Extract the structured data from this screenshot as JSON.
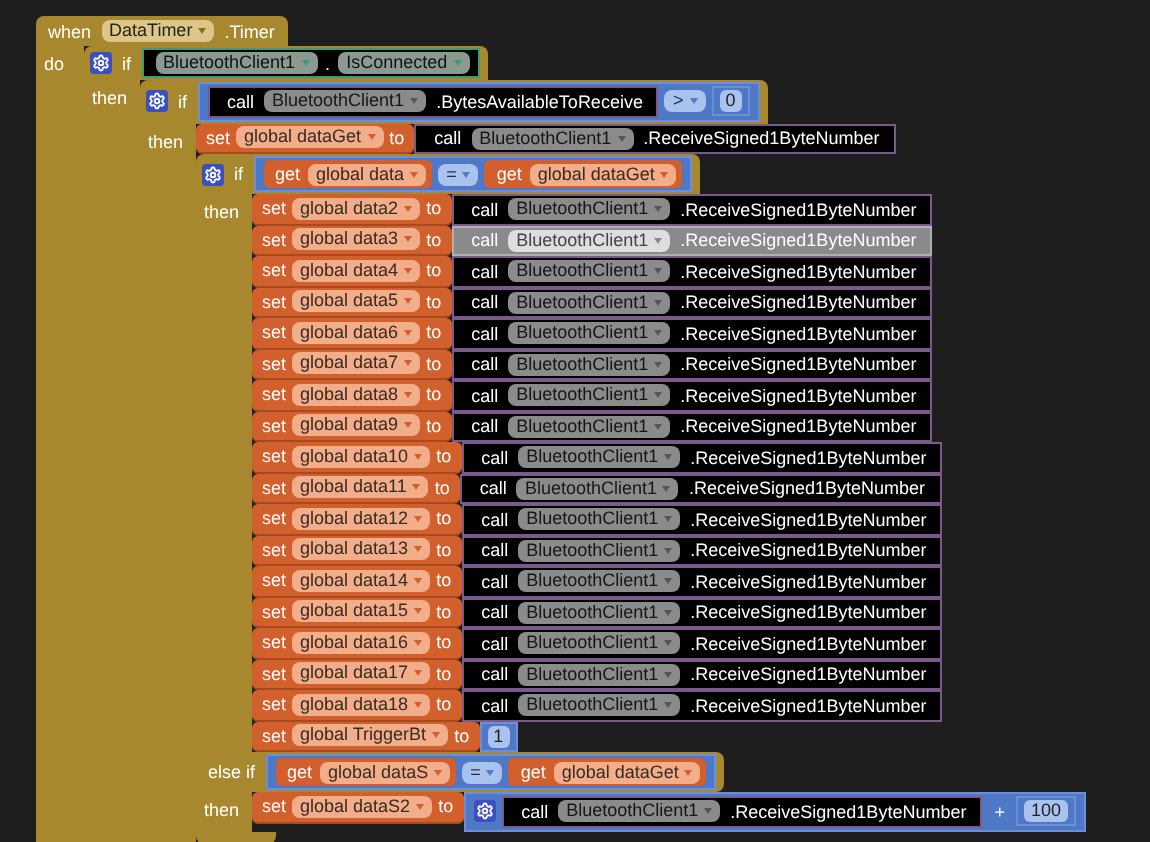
{
  "event": {
    "keyword": "when",
    "component": "DataTimer",
    "event": ".Timer",
    "body_label": "do",
    "body": [
      {
        "kind": "if",
        "keyword": "if",
        "mutator": true,
        "condition": {
          "kind": "property",
          "component": "BluetoothClient1",
          "separator": ".",
          "property": "IsConnected"
        },
        "then_label": "then",
        "body": [
          {
            "kind": "if",
            "keyword": "if",
            "mutator": true,
            "condition": {
              "kind": "compare",
              "operator": ">",
              "left": {
                "kind": "call",
                "keyword": "call",
                "component": "BluetoothClient1",
                "method": ".BytesAvailableToReceive",
                "selected": false
              },
              "right": {
                "kind": "number",
                "value": "0"
              }
            },
            "then_label": "then",
            "body": [
              {
                "kind": "set",
                "keyword": "set",
                "variable": "global dataGet",
                "to": "to",
                "value": {
                  "kind": "call",
                  "keyword": "call",
                  "component": "BluetoothClient1",
                  "method": ".ReceiveSigned1ByteNumber",
                  "selected": false
                }
              },
              {
                "kind": "if",
                "keyword": "if",
                "mutator": true,
                "condition": {
                  "kind": "compare",
                  "operator": "=",
                  "left": {
                    "kind": "get",
                    "keyword": "get",
                    "variable": "global data"
                  },
                  "right": {
                    "kind": "get",
                    "keyword": "get",
                    "variable": "global dataGet"
                  }
                },
                "then_label": "then",
                "body": [
                  {
                    "kind": "set",
                    "keyword": "set",
                    "variable": "global data2",
                    "to": "to",
                    "value": {
                      "kind": "call",
                      "keyword": "call",
                      "component": "BluetoothClient1",
                      "method": ".ReceiveSigned1ByteNumber",
                      "selected": false
                    }
                  },
                  {
                    "kind": "set",
                    "keyword": "set",
                    "variable": "global data3",
                    "to": "to",
                    "value": {
                      "kind": "call",
                      "keyword": "call",
                      "component": "BluetoothClient1",
                      "method": ".ReceiveSigned1ByteNumber",
                      "selected": true
                    }
                  },
                  {
                    "kind": "set",
                    "keyword": "set",
                    "variable": "global data4",
                    "to": "to",
                    "value": {
                      "kind": "call",
                      "keyword": "call",
                      "component": "BluetoothClient1",
                      "method": ".ReceiveSigned1ByteNumber",
                      "selected": false
                    }
                  },
                  {
                    "kind": "set",
                    "keyword": "set",
                    "variable": "global data5",
                    "to": "to",
                    "value": {
                      "kind": "call",
                      "keyword": "call",
                      "component": "BluetoothClient1",
                      "method": ".ReceiveSigned1ByteNumber",
                      "selected": false
                    }
                  },
                  {
                    "kind": "set",
                    "keyword": "set",
                    "variable": "global data6",
                    "to": "to",
                    "value": {
                      "kind": "call",
                      "keyword": "call",
                      "component": "BluetoothClient1",
                      "method": ".ReceiveSigned1ByteNumber",
                      "selected": false
                    }
                  },
                  {
                    "kind": "set",
                    "keyword": "set",
                    "variable": "global data7",
                    "to": "to",
                    "value": {
                      "kind": "call",
                      "keyword": "call",
                      "component": "BluetoothClient1",
                      "method": ".ReceiveSigned1ByteNumber",
                      "selected": false
                    }
                  },
                  {
                    "kind": "set",
                    "keyword": "set",
                    "variable": "global data8",
                    "to": "to",
                    "value": {
                      "kind": "call",
                      "keyword": "call",
                      "component": "BluetoothClient1",
                      "method": ".ReceiveSigned1ByteNumber",
                      "selected": false
                    }
                  },
                  {
                    "kind": "set",
                    "keyword": "set",
                    "variable": "global data9",
                    "to": "to",
                    "value": {
                      "kind": "call",
                      "keyword": "call",
                      "component": "BluetoothClient1",
                      "method": ".ReceiveSigned1ByteNumber",
                      "selected": false
                    }
                  },
                  {
                    "kind": "set",
                    "keyword": "set",
                    "variable": "global data10",
                    "to": "to",
                    "value": {
                      "kind": "call",
                      "keyword": "call",
                      "component": "BluetoothClient1",
                      "method": ".ReceiveSigned1ByteNumber",
                      "selected": false
                    }
                  },
                  {
                    "kind": "set",
                    "keyword": "set",
                    "variable": "global data11",
                    "to": "to",
                    "value": {
                      "kind": "call",
                      "keyword": "call",
                      "component": "BluetoothClient1",
                      "method": ".ReceiveSigned1ByteNumber",
                      "selected": false
                    }
                  },
                  {
                    "kind": "set",
                    "keyword": "set",
                    "variable": "global data12",
                    "to": "to",
                    "value": {
                      "kind": "call",
                      "keyword": "call",
                      "component": "BluetoothClient1",
                      "method": ".ReceiveSigned1ByteNumber",
                      "selected": false
                    }
                  },
                  {
                    "kind": "set",
                    "keyword": "set",
                    "variable": "global data13",
                    "to": "to",
                    "value": {
                      "kind": "call",
                      "keyword": "call",
                      "component": "BluetoothClient1",
                      "method": ".ReceiveSigned1ByteNumber",
                      "selected": false
                    }
                  },
                  {
                    "kind": "set",
                    "keyword": "set",
                    "variable": "global data14",
                    "to": "to",
                    "value": {
                      "kind": "call",
                      "keyword": "call",
                      "component": "BluetoothClient1",
                      "method": ".ReceiveSigned1ByteNumber",
                      "selected": false
                    }
                  },
                  {
                    "kind": "set",
                    "keyword": "set",
                    "variable": "global data15",
                    "to": "to",
                    "value": {
                      "kind": "call",
                      "keyword": "call",
                      "component": "BluetoothClient1",
                      "method": ".ReceiveSigned1ByteNumber",
                      "selected": false
                    }
                  },
                  {
                    "kind": "set",
                    "keyword": "set",
                    "variable": "global data16",
                    "to": "to",
                    "value": {
                      "kind": "call",
                      "keyword": "call",
                      "component": "BluetoothClient1",
                      "method": ".ReceiveSigned1ByteNumber",
                      "selected": false
                    }
                  },
                  {
                    "kind": "set",
                    "keyword": "set",
                    "variable": "global data17",
                    "to": "to",
                    "value": {
                      "kind": "call",
                      "keyword": "call",
                      "component": "BluetoothClient1",
                      "method": ".ReceiveSigned1ByteNumber",
                      "selected": false
                    }
                  },
                  {
                    "kind": "set",
                    "keyword": "set",
                    "variable": "global data18",
                    "to": "to",
                    "value": {
                      "kind": "call",
                      "keyword": "call",
                      "component": "BluetoothClient1",
                      "method": ".ReceiveSigned1ByteNumber",
                      "selected": false
                    }
                  },
                  {
                    "kind": "set",
                    "keyword": "set",
                    "variable": "global TriggerBt",
                    "to": "to",
                    "value": {
                      "kind": "number",
                      "value": "1"
                    }
                  }
                ],
                "else_ifs": [
                  {
                    "keyword": "else if",
                    "condition": {
                      "kind": "compare",
                      "operator": "=",
                      "left": {
                        "kind": "get",
                        "keyword": "get",
                        "variable": "global dataS"
                      },
                      "right": {
                        "kind": "get",
                        "keyword": "get",
                        "variable": "global dataGet"
                      }
                    },
                    "then_label": "then",
                    "body": [
                      {
                        "kind": "set",
                        "keyword": "set",
                        "variable": "global dataS2",
                        "to": "to",
                        "value": {
                          "kind": "add",
                          "mutator": true,
                          "operator": "+",
                          "left": {
                            "kind": "call",
                            "keyword": "call",
                            "component": "BluetoothClient1",
                            "method": ".ReceiveSigned1ByteNumber",
                            "selected": false
                          },
                          "right": {
                            "kind": "number",
                            "value": "100"
                          }
                        }
                      }
                    ]
                  }
                ]
              }
            ]
          }
        ]
      }
    ]
  }
}
